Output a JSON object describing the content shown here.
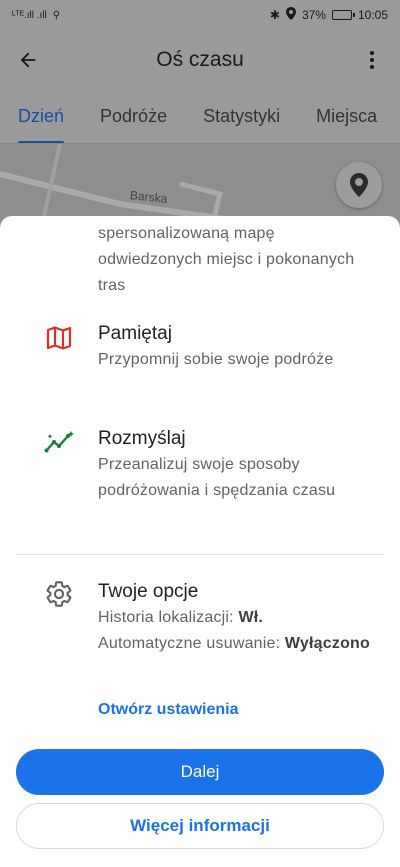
{
  "status_bar": {
    "signal_left": "ᴸᵀᴱ.ıll .ıll",
    "battery_percent": "37%",
    "time": "10:05",
    "battery_level": 0.37
  },
  "app_bar": {
    "title": "Oś czasu",
    "back_icon": "arrow-back-icon",
    "more_icon": "more-vert-icon"
  },
  "tabs": [
    {
      "label": "Dzień",
      "active": true
    },
    {
      "label": "Podróże",
      "active": false
    },
    {
      "label": "Statystyki",
      "active": false
    },
    {
      "label": "Miejsca",
      "active": false
    }
  ],
  "map": {
    "street_label": "Barska"
  },
  "sheet": {
    "intro_text": "spersonalizowaną mapę odwiedzonych miejsc i pokonanych tras",
    "features": [
      {
        "icon": "map-icon",
        "title": "Pamiętaj",
        "body": "Przypomnij sobie swoje podróże"
      },
      {
        "icon": "insights-icon",
        "title": "Rozmyślaj",
        "body": "Przeanalizuj swoje sposoby podróżowania i spędzania czasu"
      }
    ],
    "options": {
      "icon": "settings-icon",
      "title": "Twoje opcje",
      "history_label": "Historia lokalizacji: ",
      "history_value": "Wł.",
      "auto_delete_label": "Automatyczne usuwanie: ",
      "auto_delete_value": "Wyłączono"
    },
    "open_settings_label": "Otwórz ustawienia",
    "continue_label": "Dalej",
    "more_info_label": "Więcej informacji"
  },
  "colors": {
    "accent": "#1a73e8",
    "map_icon": "#d93025",
    "insights_icon": "#188038",
    "scrim": "#9a9a9a"
  }
}
